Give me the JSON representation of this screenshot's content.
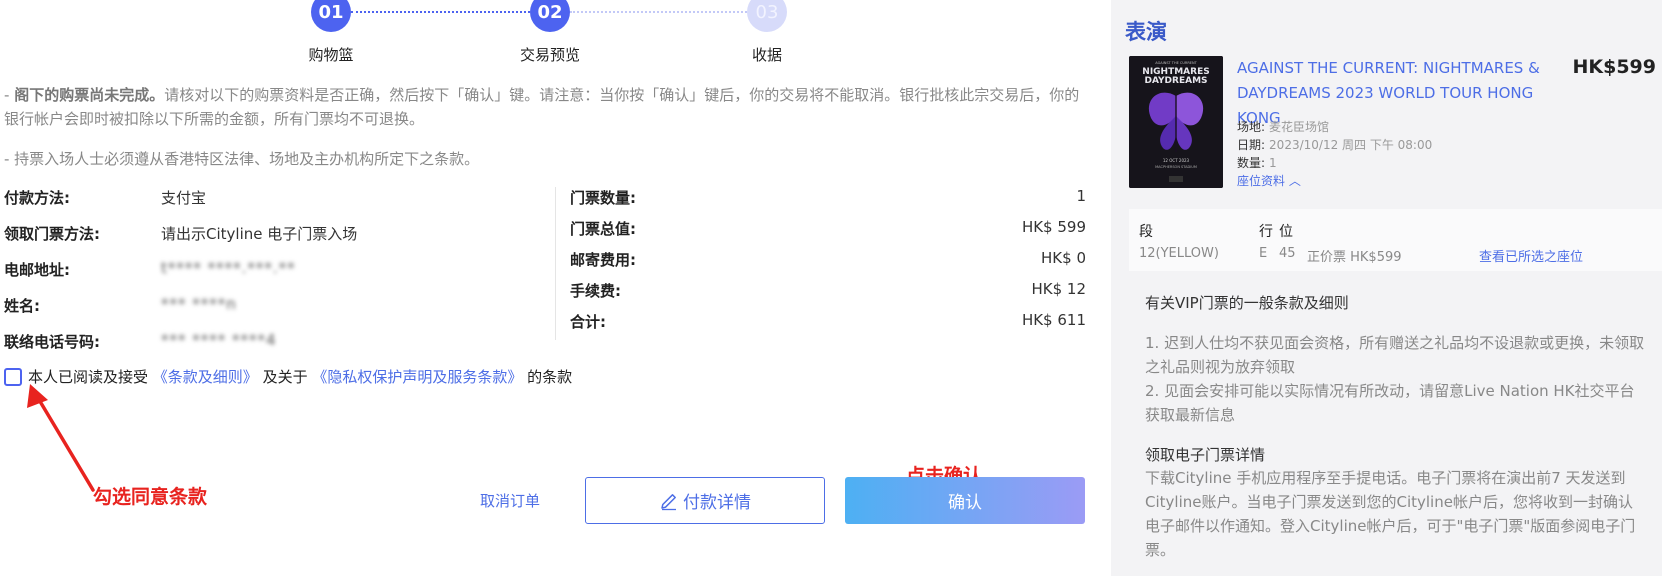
{
  "stepper": {
    "steps": [
      {
        "num": "01",
        "label": "购物篮"
      },
      {
        "num": "02",
        "label": "交易预览"
      },
      {
        "num": "03",
        "label": "收据"
      }
    ]
  },
  "notices": {
    "n1_bold": "阁下的购票尚未完成。",
    "n1_rest": "请核对以下的购票资料是否正确，然后按下「确认」键。请注意：当你按「确认」键后，你的交易将不能取消。银行批核此宗交易后，你的银行帐户会即时被扣除以下所需的金额，所有门票均不可退换。",
    "n2": "- 持票入场人士必须遵从香港特区法律、场地及主办机构所定下之条款。",
    "dash": "- "
  },
  "info": {
    "payment_label": "付款方法:",
    "payment_value": "支付宝",
    "pickup_label": "领取门票方法:",
    "pickup_value": "请出示Cityline 电子门票入场",
    "email_label": "电邮地址:",
    "email_value": "t**** ****.***.**",
    "name_label": "姓名:",
    "name_value": "*** ****n",
    "phone_label": "联络电话号码:",
    "phone_value": "*** **** ****4"
  },
  "fees": {
    "qty_label": "门票数量:",
    "qty_value": "1",
    "total_label": "门票总值:",
    "total_value": "HK$ 599",
    "postage_label": "邮寄费用:",
    "postage_value": "HK$ 0",
    "handling_label": "手续费:",
    "handling_value": "HK$ 12",
    "sum_label": "合计:",
    "sum_value": "HK$ 611"
  },
  "agreement": {
    "prefix": "本人已阅读及接受",
    "terms_link": "《条款及细则》",
    "mid": " 及关于 ",
    "privacy_link": "《隐私权保护声明及服务条款》",
    "suffix": " 的条款"
  },
  "annotations": {
    "check_hint": "勾选同意条款",
    "confirm_hint": "点击确认"
  },
  "buttons": {
    "cancel": "取消订单",
    "detail": "付款详情",
    "confirm": "确认"
  },
  "panel": {
    "title": "表演",
    "event_title": "AGAINST THE CURRENT: NIGHTMARES & DAYDREAMS 2023 WORLD TOUR HONG KONG",
    "price": "HK$599",
    "venue_label": "场地:",
    "venue_value": "麦花臣场馆",
    "date_label": "日期:",
    "date_value": "2023/10/12 周四 下午 08:00",
    "qty_label": "数量:",
    "qty_value": "1",
    "seat_info_link": "座位资料",
    "poster": {
      "line1": "NIGHTMARES",
      "line2": "DAYDREAMS",
      "small_top": "AGAINST THE CURRENT",
      "small_date": "12 OCT 2023",
      "small_venue": "MACPHERSON STADIUM"
    },
    "seat_headers": {
      "section": "段",
      "row": "行",
      "seat": "位"
    },
    "seat_values": {
      "section": "12(YELLOW)",
      "row": "E",
      "seat": "45",
      "price": "正价票 HK$599"
    },
    "view_seat_link": "查看已所选之座位",
    "vip_heading": "有关VIP门票的一般条款及细则",
    "vip_1": "1. 迟到人仕均不获见面会资格，所有赠送之礼品均不设退款或更换，未领取之礼品则视为放弃领取",
    "vip_2": "2. 见面会安排可能以实际情况有所改动，请留意Live Nation HK社交平台获取最新信息",
    "eticket_heading": "领取电子门票详情",
    "eticket_text": "下载Cityline 手机应用程序至手提电话。电子门票将在演出前7 天发送到Cityline账户。当电子门票发送到您的Cityline帐户后，您将收到一封确认电子邮件以作通知。登入Cityline帐户后，可于\"电子门票\"版面参阅电子门票。"
  },
  "colors": {
    "accent": "#4d63f0",
    "link": "#4d6ee6",
    "annotation": "#e8231f",
    "panel_bg": "#f3f3f5"
  }
}
